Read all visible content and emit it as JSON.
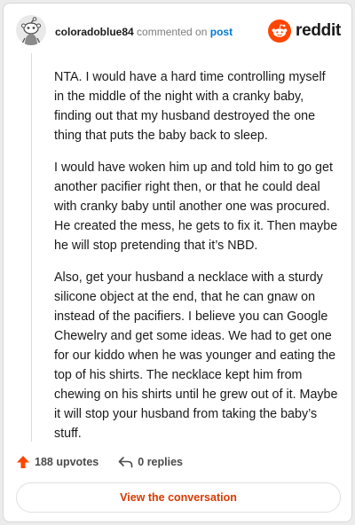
{
  "header": {
    "username": "coloradoblue84",
    "action_text": "commented on",
    "post_link": "post",
    "brand": "reddit"
  },
  "comment": {
    "paragraphs": [
      "NTA. I would have a hard time controlling myself in the middle of the night with a cranky baby, finding out that my husband destroyed the one thing that puts the baby back to sleep.",
      "I would have woken him up and told him to go get another pacifier right then, or that he could deal with cranky baby until another one was procured. He created the mess, he gets to fix it. Then maybe he will stop pretending that it’s NBD.",
      "Also, get your husband a necklace with a sturdy silicone object at the end, that he can gnaw on instead of the pacifiers. I believe you can Google Chewelry and get some ideas. We had to get one for our kiddo when he was younger and eating the top of his shirts. The necklace kept him from chewing on his shirts until he grew out of it. Maybe it will stop your husband from taking the baby’s stuff."
    ]
  },
  "actions": {
    "upvotes": "188 upvotes",
    "replies": "0 replies"
  },
  "cta": {
    "label": "View the conversation"
  },
  "colors": {
    "brand_orange": "#ff4500",
    "cta_text": "#d93a00",
    "link_blue": "#0079d3"
  },
  "icons": [
    "snoo-avatar-icon",
    "reddit-logo-icon",
    "upvote-arrow-icon",
    "reply-arrow-icon"
  ]
}
